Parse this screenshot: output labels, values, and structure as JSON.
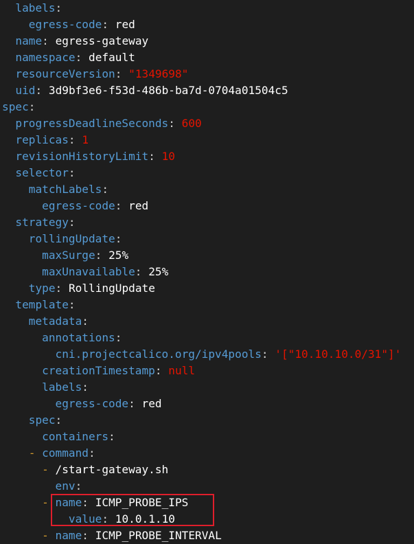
{
  "editor": {
    "theme": {
      "background": "#1e1e1e",
      "key": "#569cd6",
      "value": "#ffffff",
      "number_string_null": "#e51400",
      "dash": "#d19a2e",
      "highlight_border": "#e01e2b"
    },
    "lines": [
      {
        "indent": 1,
        "dash": false,
        "key": "labels",
        "value": "",
        "value_type": "none"
      },
      {
        "indent": 2,
        "dash": false,
        "key": "egress-code",
        "value": "red",
        "value_type": "plain"
      },
      {
        "indent": 1,
        "dash": false,
        "key": "name",
        "value": "egress-gateway",
        "value_type": "plain"
      },
      {
        "indent": 1,
        "dash": false,
        "key": "namespace",
        "value": "default",
        "value_type": "plain"
      },
      {
        "indent": 1,
        "dash": false,
        "key": "resourceVersion",
        "value": "\"1349698\"",
        "value_type": "str"
      },
      {
        "indent": 1,
        "dash": false,
        "key": "uid",
        "value": "3d9bf3e6-f53d-486b-ba7d-0704a01504c5",
        "value_type": "plain"
      },
      {
        "indent": 0,
        "dash": false,
        "key": "spec",
        "value": "",
        "value_type": "none"
      },
      {
        "indent": 1,
        "dash": false,
        "key": "progressDeadlineSeconds",
        "value": "600",
        "value_type": "num"
      },
      {
        "indent": 1,
        "dash": false,
        "key": "replicas",
        "value": "1",
        "value_type": "num"
      },
      {
        "indent": 1,
        "dash": false,
        "key": "revisionHistoryLimit",
        "value": "10",
        "value_type": "num"
      },
      {
        "indent": 1,
        "dash": false,
        "key": "selector",
        "value": "",
        "value_type": "none"
      },
      {
        "indent": 2,
        "dash": false,
        "key": "matchLabels",
        "value": "",
        "value_type": "none"
      },
      {
        "indent": 3,
        "dash": false,
        "key": "egress-code",
        "value": "red",
        "value_type": "plain"
      },
      {
        "indent": 1,
        "dash": false,
        "key": "strategy",
        "value": "",
        "value_type": "none"
      },
      {
        "indent": 2,
        "dash": false,
        "key": "rollingUpdate",
        "value": "",
        "value_type": "none"
      },
      {
        "indent": 3,
        "dash": false,
        "key": "maxSurge",
        "value": "25%",
        "value_type": "plain"
      },
      {
        "indent": 3,
        "dash": false,
        "key": "maxUnavailable",
        "value": "25%",
        "value_type": "plain"
      },
      {
        "indent": 2,
        "dash": false,
        "key": "type",
        "value": "RollingUpdate",
        "value_type": "plain"
      },
      {
        "indent": 1,
        "dash": false,
        "key": "template",
        "value": "",
        "value_type": "none"
      },
      {
        "indent": 2,
        "dash": false,
        "key": "metadata",
        "value": "",
        "value_type": "none"
      },
      {
        "indent": 3,
        "dash": false,
        "key": "annotations",
        "value": "",
        "value_type": "none"
      },
      {
        "indent": 4,
        "dash": false,
        "key": "cni.projectcalico.org/ipv4pools",
        "value": "'[\"10.10.10.0/31\"]'",
        "value_type": "str"
      },
      {
        "indent": 3,
        "dash": false,
        "key": "creationTimestamp",
        "value": "null",
        "value_type": "null"
      },
      {
        "indent": 3,
        "dash": false,
        "key": "labels",
        "value": "",
        "value_type": "none"
      },
      {
        "indent": 4,
        "dash": false,
        "key": "egress-code",
        "value": "red",
        "value_type": "plain"
      },
      {
        "indent": 2,
        "dash": false,
        "key": "spec",
        "value": "",
        "value_type": "none"
      },
      {
        "indent": 3,
        "dash": false,
        "key": "containers",
        "value": "",
        "value_type": "none"
      },
      {
        "indent": 3,
        "dash": true,
        "key": "command",
        "value": "",
        "value_type": "none"
      },
      {
        "indent": 4,
        "dash": true,
        "key": "",
        "value": "/start-gateway.sh",
        "value_type": "plain"
      },
      {
        "indent": 4,
        "dash": false,
        "key": "env",
        "value": "",
        "value_type": "none"
      },
      {
        "indent": 4,
        "dash": true,
        "key": "name",
        "value": "ICMP_PROBE_IPS",
        "value_type": "plain"
      },
      {
        "indent": 5,
        "dash": false,
        "key": "value",
        "value": "10.0.1.10",
        "value_type": "plain"
      },
      {
        "indent": 4,
        "dash": true,
        "key": "name",
        "value": "ICMP_PROBE_INTERVAL",
        "value_type": "plain"
      }
    ]
  }
}
